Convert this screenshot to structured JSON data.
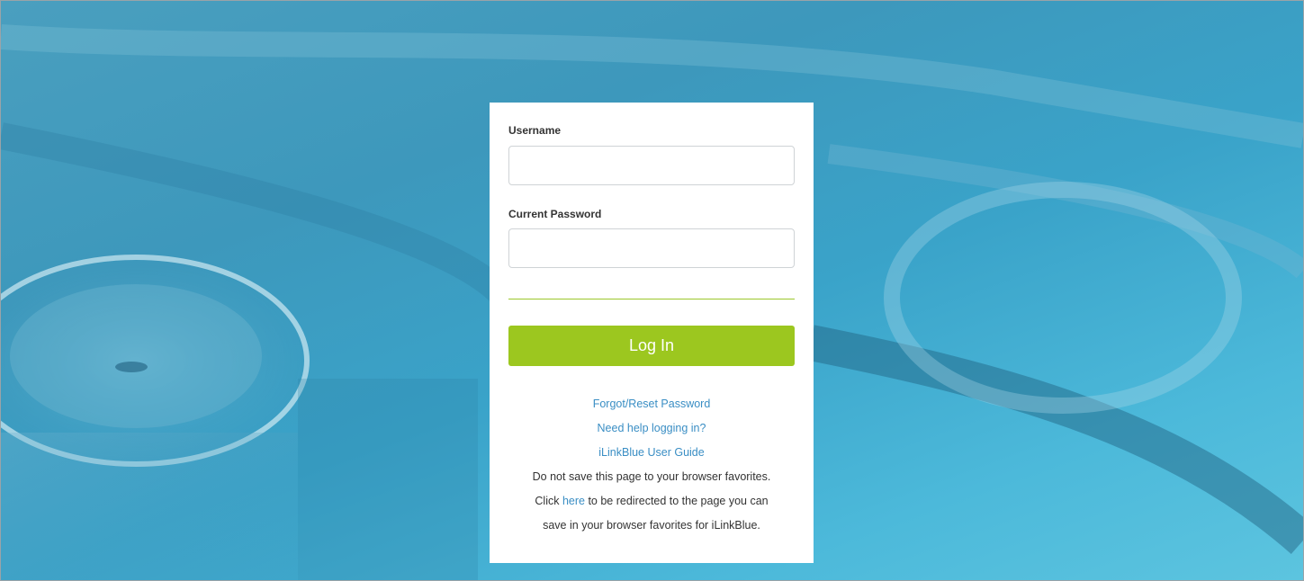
{
  "login_form": {
    "username_label": "Username",
    "username_value": "",
    "password_label": "Current Password",
    "password_value": "",
    "login_button_label": "Log In",
    "links": {
      "forgot_password": "Forgot/Reset Password",
      "need_help": "Need help logging in?",
      "user_guide": "iLinkBlue User Guide"
    },
    "notice": {
      "line1": "Do not save this page to your browser favorites.",
      "click_prefix": "Click ",
      "here_link": "here",
      "click_suffix": " to be redirected to the page you can",
      "line3": "save in your browser favorites for iLinkBlue."
    }
  },
  "colors": {
    "accent_green": "#9cc71f",
    "link_blue": "#3a8ec4",
    "background_blue": "#3d98bc"
  }
}
